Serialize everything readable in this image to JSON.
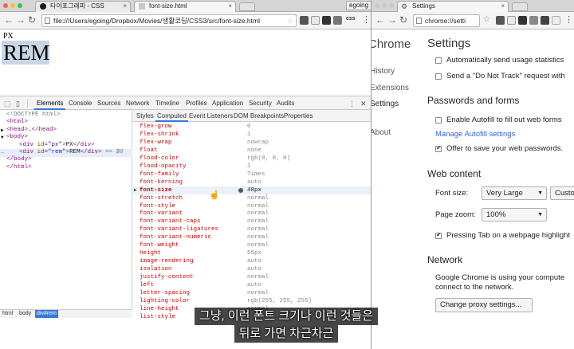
{
  "left_browser": {
    "tabs": [
      {
        "label": "타이포그래피 - CSS",
        "favicon_color": "#1a1a1a"
      },
      {
        "label": "font-size.html",
        "favicon_color": "#c8c8c8"
      }
    ],
    "profile": "egoing",
    "url": "file:///Users/egoing/Dropbox/Movies/생활코딩/CSS3/src/font-size.html",
    "page": {
      "px_text": "PX",
      "rem_text": "REM"
    }
  },
  "devtools": {
    "tabs": [
      "Elements",
      "Console",
      "Sources",
      "Network",
      "Timeline",
      "Profiles",
      "Application",
      "Security",
      "Audits"
    ],
    "selected_tab": "Elements",
    "elements": [
      {
        "indent": 0,
        "type": "comment",
        "text": "<!DOCTYPE html>"
      },
      {
        "indent": 0,
        "type": "open",
        "tag": "html",
        "suffix": ">"
      },
      {
        "indent": 0,
        "toggle": "▶",
        "type": "open",
        "tag": "head",
        "suffix": ">…</head>"
      },
      {
        "indent": 0,
        "toggle": "▼",
        "type": "open",
        "tag": "body",
        "suffix": ">"
      },
      {
        "indent": 1,
        "type": "div",
        "id": "px",
        "content": "PX"
      },
      {
        "indent": 1,
        "type": "div",
        "id": "rem",
        "content": "REM",
        "selected": true,
        "marker": "== $0"
      },
      {
        "indent": 0,
        "type": "close",
        "text": "</body>"
      },
      {
        "indent": 0,
        "type": "close",
        "text": "</html>"
      }
    ],
    "breadcrumbs": [
      "html",
      "body",
      "div#rem"
    ],
    "styles_tabs": [
      "Styles",
      "Computed",
      "Event Listeners",
      "DOM Breakpoints",
      "Properties"
    ],
    "styles_selected": "Computed",
    "computed": [
      {
        "name": "flex-grow",
        "value": "0"
      },
      {
        "name": "flex-shrink",
        "value": "1"
      },
      {
        "name": "flex-wrap",
        "value": "nowrap"
      },
      {
        "name": "float",
        "value": "none"
      },
      {
        "name": "flood-color",
        "value": "rgb(0, 0, 0)"
      },
      {
        "name": "flood-opacity",
        "value": "1"
      },
      {
        "name": "font-family",
        "value": "Times"
      },
      {
        "name": "font-kerning",
        "value": "auto"
      },
      {
        "name": "font-size",
        "value": "48px",
        "expanded": true
      },
      {
        "name": "font-stretch",
        "value": "normal"
      },
      {
        "name": "font-style",
        "value": "normal"
      },
      {
        "name": "font-variant",
        "value": "normal"
      },
      {
        "name": "font-variant-caps",
        "value": "normal"
      },
      {
        "name": "font-variant-ligatures",
        "value": "normal"
      },
      {
        "name": "font-variant-numeric",
        "value": "normal"
      },
      {
        "name": "font-weight",
        "value": "normal"
      },
      {
        "name": "height",
        "value": "55px"
      },
      {
        "name": "image-rendering",
        "value": "auto"
      },
      {
        "name": "isolation",
        "value": "auto"
      },
      {
        "name": "justify-content",
        "value": "normal"
      },
      {
        "name": "left",
        "value": "auto"
      },
      {
        "name": "letter-spacing",
        "value": "normal"
      },
      {
        "name": "lighting-color",
        "value": "rgb(255, 255, 255)"
      },
      {
        "name": "line-height",
        "value": "normal"
      },
      {
        "name": "list-style",
        "value": ""
      }
    ]
  },
  "right_browser": {
    "tab": "Settings",
    "url": "chrome://setti",
    "sidebar": {
      "title": "Chrome",
      "items": [
        "History",
        "Extensions",
        "Settings",
        "About"
      ]
    },
    "heading": "Settings",
    "items": {
      "auto_usage": "Automatically send usage statistics",
      "dnt": "Send a \"Do Not Track\" request with",
      "passwords_heading": "Passwords and forms",
      "autofill": "Enable Autofill to fill out web forms",
      "manage_autofill": "Manage Autofill settings",
      "offer_save": "Offer to save your web passwords.",
      "web_content_heading": "Web content",
      "font_size_label": "Font size:",
      "font_size_value": "Very Large",
      "customize": "Custo",
      "page_zoom_label": "Page zoom:",
      "page_zoom_value": "100%",
      "tab_highlight": "Pressing Tab on a webpage highlight",
      "network_heading": "Network",
      "network_desc_1": "Google Chrome is using your compute",
      "network_desc_2": "connect to the network.",
      "proxy_button": "Change proxy settings..."
    },
    "checkboxes": {
      "auto_usage": false,
      "dnt": false,
      "autofill": false,
      "offer_save": true,
      "tab_highlight": true
    }
  },
  "subtitles": [
    "그냥, 이런 폰트 크기나 이런 것들은",
    "뒤로 가면 차근차근"
  ]
}
